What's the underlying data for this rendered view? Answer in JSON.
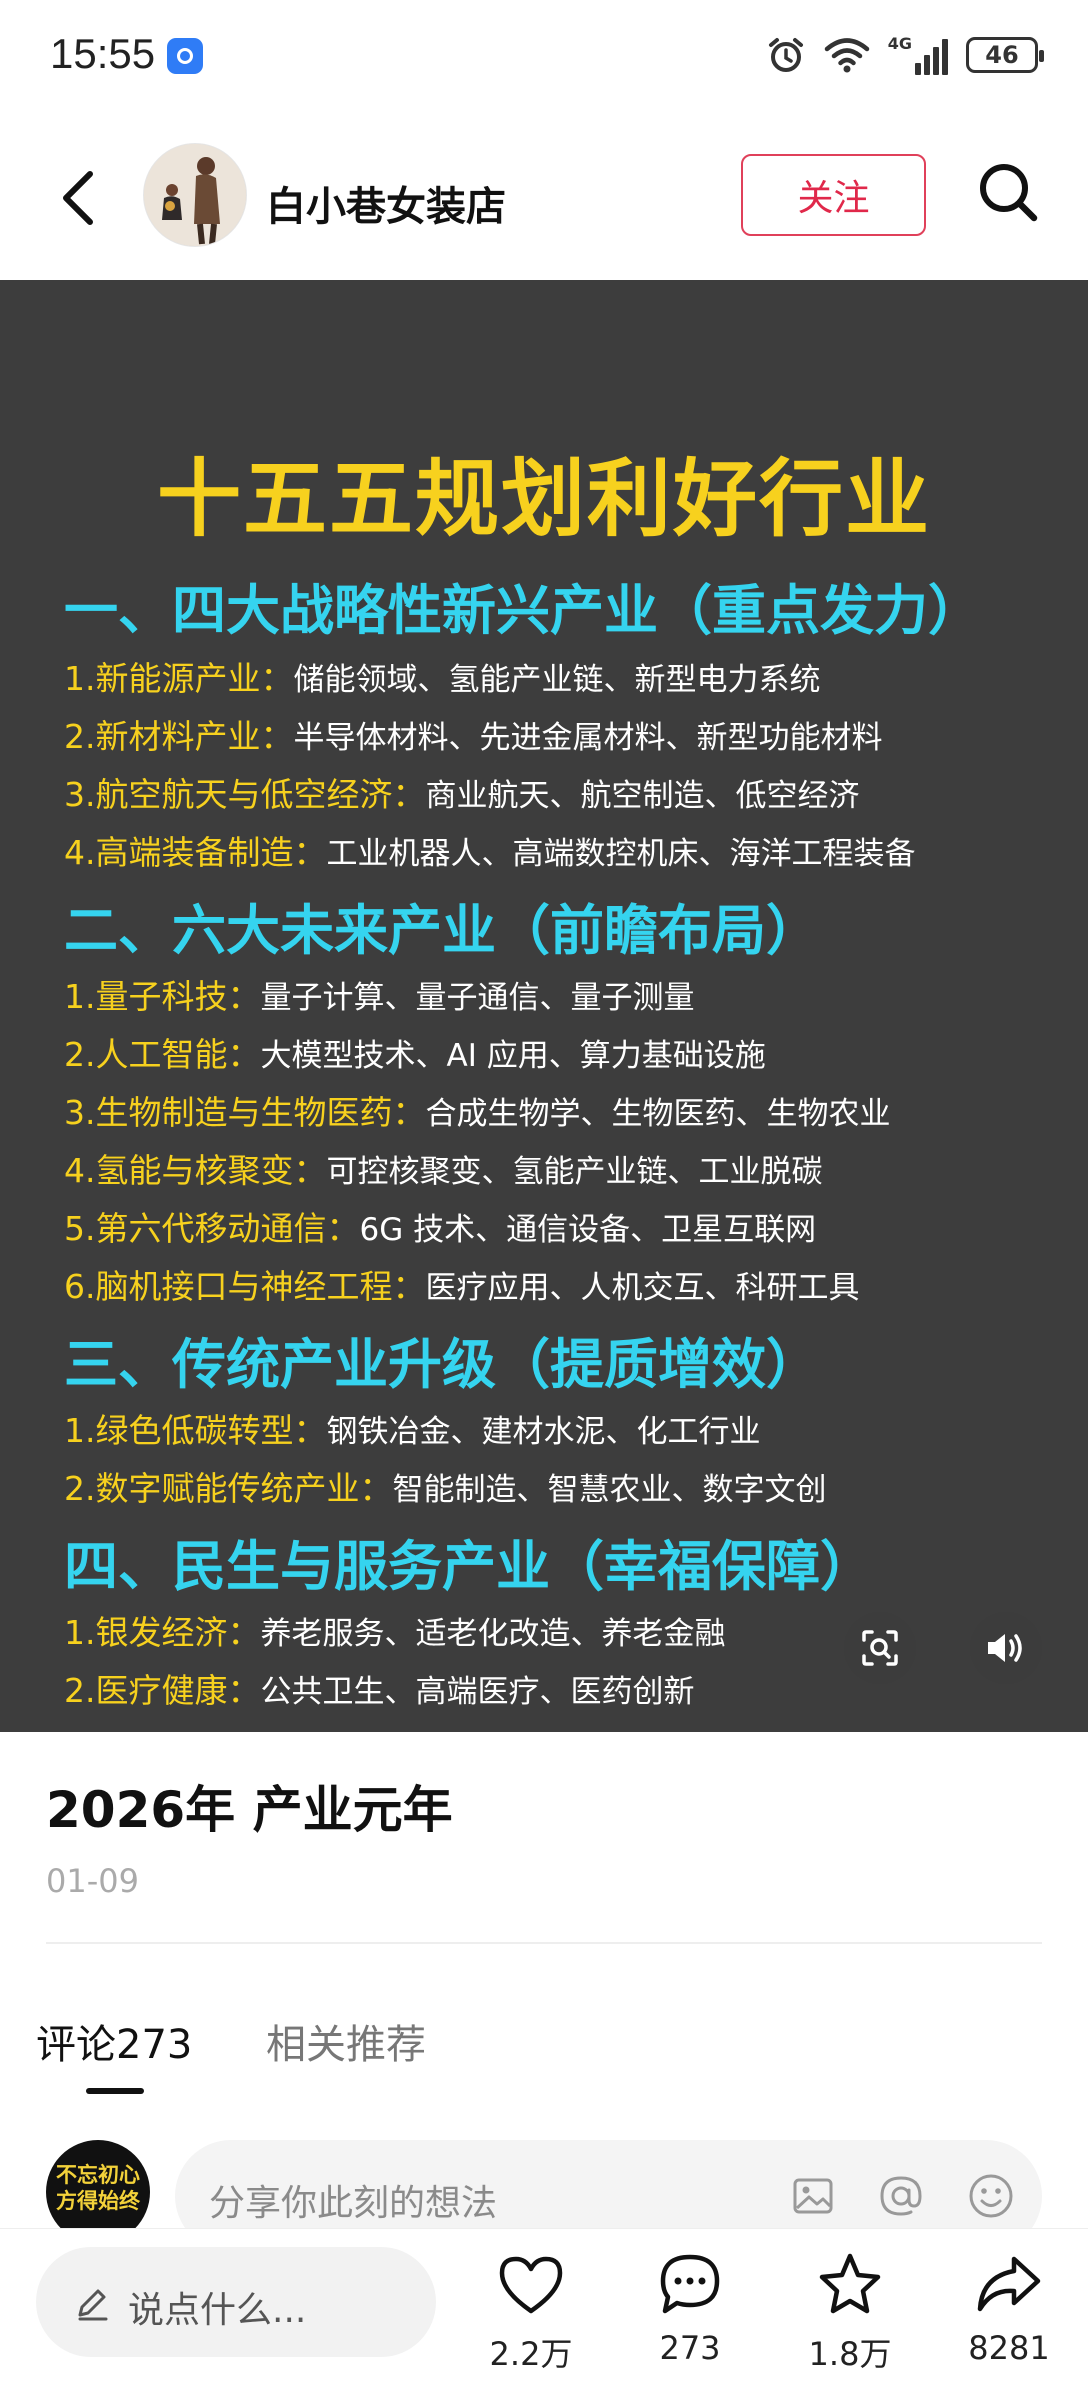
{
  "status_bar": {
    "time": "15:55",
    "network": "4G",
    "battery": "46"
  },
  "header": {
    "shop_name": "白小巷女装店",
    "follow_label": "关注"
  },
  "post_image": {
    "title": "十五五规划利好行业",
    "sections": [
      {
        "heading": "一、四大战略性新兴产业（重点发力）",
        "rows": [
          {
            "label": "1.新能源产业：",
            "value": "储能领域、氢能产业链、新型电力系统"
          },
          {
            "label": "2.新材料产业：",
            "value": "半导体材料、先进金属材料、新型功能材料"
          },
          {
            "label": "3.航空航天与低空经济：",
            "value": "商业航天、航空制造、低空经济"
          },
          {
            "label": "4.高端装备制造：",
            "value": "工业机器人、高端数控机床、海洋工程装备"
          }
        ]
      },
      {
        "heading": "二、六大未来产业（前瞻布局）",
        "rows": [
          {
            "label": "1.量子科技：",
            "value": "量子计算、量子通信、量子测量"
          },
          {
            "label": "2.人工智能：",
            "value": "大模型技术、AI 应用、算力基础设施"
          },
          {
            "label": "3.生物制造与生物医药：",
            "value": "合成生物学、生物医药、生物农业"
          },
          {
            "label": "4.氢能与核聚变：",
            "value": "可控核聚变、氢能产业链、工业脱碳"
          },
          {
            "label": "5.第六代移动通信：",
            "value": "6G 技术、通信设备、卫星互联网"
          },
          {
            "label": "6.脑机接口与神经工程：",
            "value": "医疗应用、人机交互、科研工具"
          }
        ]
      },
      {
        "heading": "三、传统产业升级（提质增效）",
        "rows": [
          {
            "label": "1.绿色低碳转型：",
            "value": "钢铁冶金、建材水泥、化工行业"
          },
          {
            "label": "2.数字赋能传统产业：",
            "value": "智能制造、智慧农业、数字文创"
          }
        ]
      },
      {
        "heading": "四、民生与服务产业（幸福保障）",
        "rows": [
          {
            "label": "1.银发经济：",
            "value": "养老服务、适老化改造、养老金融"
          },
          {
            "label": "2.医疗健康：",
            "value": "公共卫生、高端医疗、医药创新"
          }
        ]
      }
    ]
  },
  "post": {
    "title": "2026年 产业元年",
    "date": "01-09"
  },
  "tabs": [
    {
      "label": "评论273",
      "active": true
    },
    {
      "label": "相关推荐",
      "active": false
    }
  ],
  "comment_box": {
    "avatar_text": "不忘初心方得始终",
    "placeholder": "分享你此刻的想法"
  },
  "bottom_bar": {
    "say_placeholder": "说点什么...",
    "likes": "2.2万",
    "comments": "273",
    "favorites": "1.8万",
    "shares": "8281"
  },
  "colors": {
    "accent_red": "#e0284a",
    "title_yellow": "#f7d11e",
    "heading_cyan": "#35d4ef",
    "image_bg": "#3d3d3d"
  }
}
